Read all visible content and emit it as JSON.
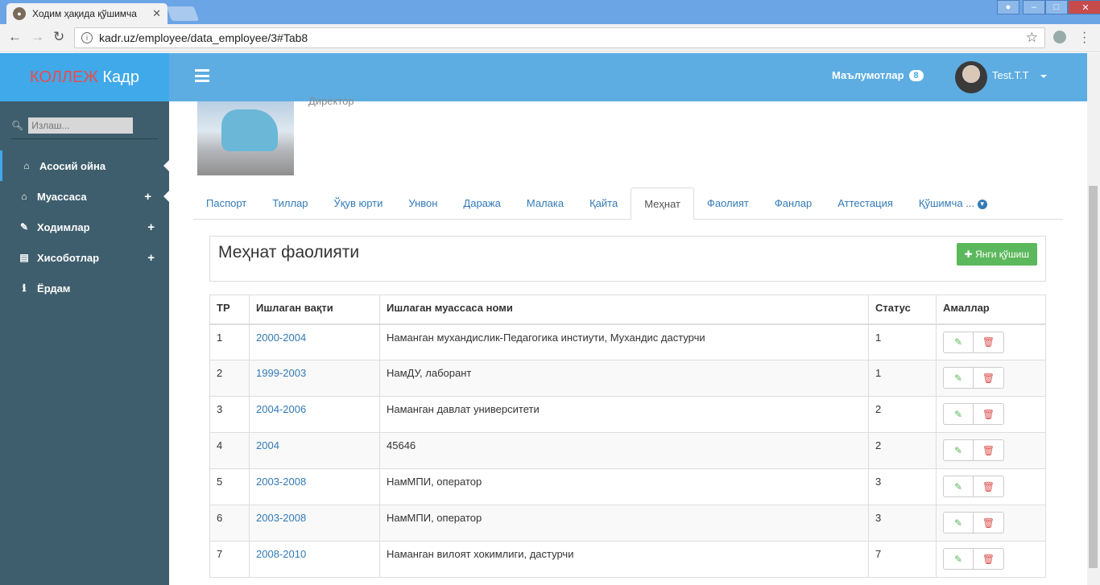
{
  "browser": {
    "tab_title": "Ходим ҳақида қўшимча",
    "url": "kadr.uz/employee/data_employee/3#Tab8"
  },
  "app": {
    "brand_red": "КОЛЛЕЖ",
    "brand_white": "Кадр"
  },
  "sidebar": {
    "search_placeholder": "Излаш...",
    "items": [
      {
        "label": "Асосий ойна",
        "icon": "home-icon"
      },
      {
        "label": "Муассаса",
        "icon": "home-icon"
      },
      {
        "label": "Ходимлар",
        "icon": "edit-icon"
      },
      {
        "label": "Хисоботлар",
        "icon": "list-icon"
      },
      {
        "label": "Ёрдам",
        "icon": "info-icon"
      }
    ]
  },
  "header": {
    "notifications_label": "Маълумотлар",
    "notifications_count": "8",
    "user_name": "Test.T.T"
  },
  "profile": {
    "ghost_text": "Директор"
  },
  "tabs": [
    "Паспорт",
    "Тиллар",
    "Ўқув юрти",
    "Унвон",
    "Даража",
    "Малака",
    "Қайта",
    "Меҳнат",
    "Фаолият",
    "Фанлар",
    "Аттестация",
    "Қўшимча ..."
  ],
  "panel": {
    "title": "Меҳнат фаолияти",
    "add_button": "Янги қўшиш"
  },
  "table": {
    "headers": [
      "ТР",
      "Ишлаган вақти",
      "Ишлаган муассаса номи",
      "Статус",
      "Амаллар"
    ],
    "rows": [
      [
        "1",
        "2000-2004",
        "Наманган мухандислик-Педагогика инстиути, Мухандис дастурчи",
        "1"
      ],
      [
        "2",
        "1999-2003",
        "НамДУ, лаборант",
        "1"
      ],
      [
        "3",
        "2004-2006",
        "Наманган давлат университети",
        "2"
      ],
      [
        "4",
        "2004",
        "45646",
        "2"
      ],
      [
        "5",
        "2003-2008",
        "НамМПИ, оператор",
        "3"
      ],
      [
        "6",
        "2003-2008",
        "НамМПИ, оператор",
        "3"
      ],
      [
        "7",
        "2008-2010",
        "Наманган вилоят хокимлиги, дастурчи",
        "7"
      ]
    ]
  },
  "colors": {
    "accent": "#40a9e9",
    "sidebar": "#3e5e6d",
    "success": "#5cb85c",
    "danger": "#d9534f"
  }
}
